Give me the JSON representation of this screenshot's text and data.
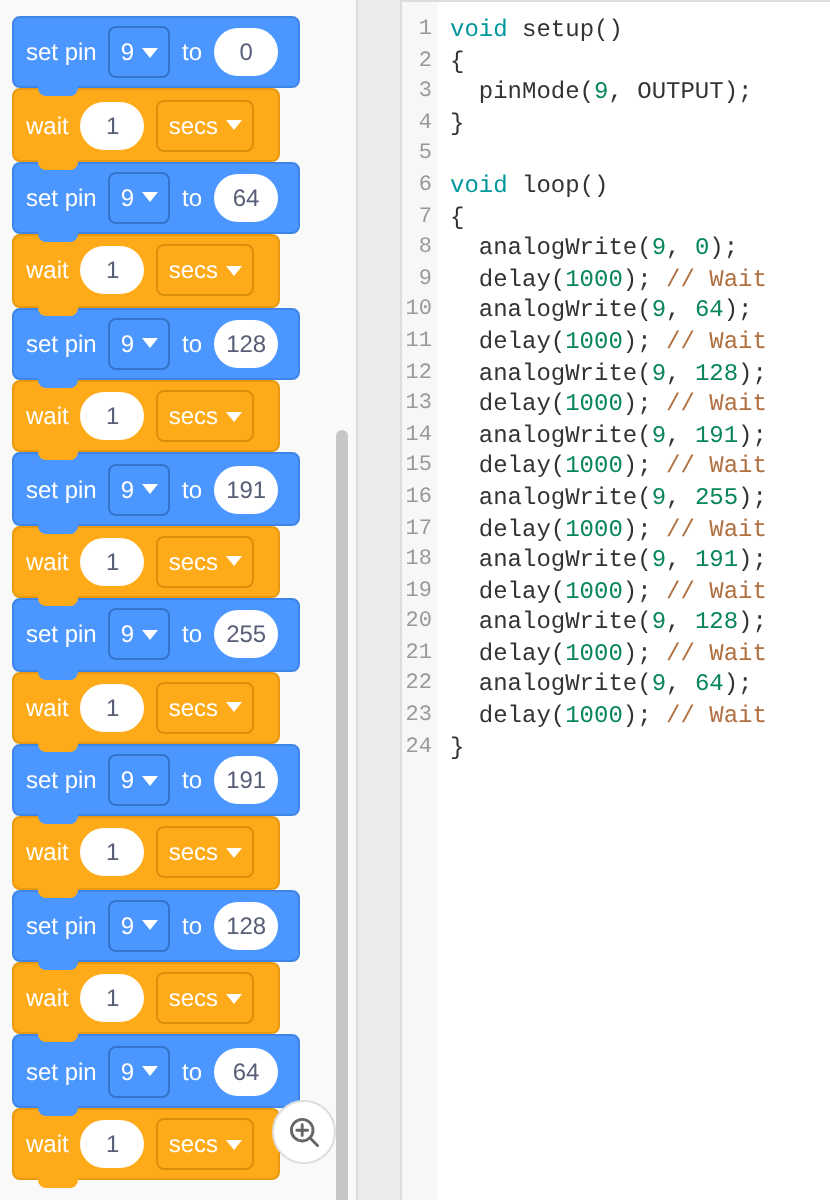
{
  "blocks": [
    {
      "kind": "set_pin",
      "label": "set pin",
      "pin": "9",
      "connector": "to",
      "value": "0"
    },
    {
      "kind": "wait",
      "label": "wait",
      "amount": "1",
      "unit": "secs"
    },
    {
      "kind": "set_pin",
      "label": "set pin",
      "pin": "9",
      "connector": "to",
      "value": "64"
    },
    {
      "kind": "wait",
      "label": "wait",
      "amount": "1",
      "unit": "secs"
    },
    {
      "kind": "set_pin",
      "label": "set pin",
      "pin": "9",
      "connector": "to",
      "value": "128"
    },
    {
      "kind": "wait",
      "label": "wait",
      "amount": "1",
      "unit": "secs"
    },
    {
      "kind": "set_pin",
      "label": "set pin",
      "pin": "9",
      "connector": "to",
      "value": "191"
    },
    {
      "kind": "wait",
      "label": "wait",
      "amount": "1",
      "unit": "secs"
    },
    {
      "kind": "set_pin",
      "label": "set pin",
      "pin": "9",
      "connector": "to",
      "value": "255"
    },
    {
      "kind": "wait",
      "label": "wait",
      "amount": "1",
      "unit": "secs"
    },
    {
      "kind": "set_pin",
      "label": "set pin",
      "pin": "9",
      "connector": "to",
      "value": "191"
    },
    {
      "kind": "wait",
      "label": "wait",
      "amount": "1",
      "unit": "secs"
    },
    {
      "kind": "set_pin",
      "label": "set pin",
      "pin": "9",
      "connector": "to",
      "value": "128"
    },
    {
      "kind": "wait",
      "label": "wait",
      "amount": "1",
      "unit": "secs"
    },
    {
      "kind": "set_pin",
      "label": "set pin",
      "pin": "9",
      "connector": "to",
      "value": "64"
    },
    {
      "kind": "wait",
      "label": "wait",
      "amount": "1",
      "unit": "secs"
    }
  ],
  "code": [
    {
      "number": "1",
      "tokens": [
        {
          "kind": "kw",
          "text": "void"
        },
        {
          "kind": "plain",
          "text": " setup()"
        }
      ]
    },
    {
      "number": "2",
      "tokens": [
        {
          "kind": "plain",
          "text": "{"
        }
      ]
    },
    {
      "number": "3",
      "tokens": [
        {
          "kind": "plain",
          "text": "  pinMode("
        },
        {
          "kind": "num",
          "text": "9"
        },
        {
          "kind": "plain",
          "text": ", OUTPUT);"
        }
      ]
    },
    {
      "number": "4",
      "tokens": [
        {
          "kind": "plain",
          "text": "}"
        }
      ]
    },
    {
      "number": "5"
    },
    {
      "number": "6",
      "tokens": [
        {
          "kind": "kw",
          "text": "void"
        },
        {
          "kind": "plain",
          "text": " loop()"
        }
      ]
    },
    {
      "number": "7",
      "tokens": [
        {
          "kind": "plain",
          "text": "{"
        }
      ]
    },
    {
      "number": "8",
      "tokens": [
        {
          "kind": "plain",
          "text": "  analogWrite("
        },
        {
          "kind": "num",
          "text": "9"
        },
        {
          "kind": "plain",
          "text": ", "
        },
        {
          "kind": "num",
          "text": "0"
        },
        {
          "kind": "plain",
          "text": ");"
        }
      ]
    },
    {
      "number": "9",
      "tokens": [
        {
          "kind": "plain",
          "text": "  delay("
        },
        {
          "kind": "num",
          "text": "1000"
        },
        {
          "kind": "plain",
          "text": "); "
        },
        {
          "kind": "comment",
          "text": "// Wait"
        }
      ]
    },
    {
      "number": "10",
      "tokens": [
        {
          "kind": "plain",
          "text": "  analogWrite("
        },
        {
          "kind": "num",
          "text": "9"
        },
        {
          "kind": "plain",
          "text": ", "
        },
        {
          "kind": "num",
          "text": "64"
        },
        {
          "kind": "plain",
          "text": ");"
        }
      ]
    },
    {
      "number": "11",
      "tokens": [
        {
          "kind": "plain",
          "text": "  delay("
        },
        {
          "kind": "num",
          "text": "1000"
        },
        {
          "kind": "plain",
          "text": "); "
        },
        {
          "kind": "comment",
          "text": "// Wait"
        }
      ]
    },
    {
      "number": "12",
      "tokens": [
        {
          "kind": "plain",
          "text": "  analogWrite("
        },
        {
          "kind": "num",
          "text": "9"
        },
        {
          "kind": "plain",
          "text": ", "
        },
        {
          "kind": "num",
          "text": "128"
        },
        {
          "kind": "plain",
          "text": ");"
        }
      ]
    },
    {
      "number": "13",
      "tokens": [
        {
          "kind": "plain",
          "text": "  delay("
        },
        {
          "kind": "num",
          "text": "1000"
        },
        {
          "kind": "plain",
          "text": "); "
        },
        {
          "kind": "comment",
          "text": "// Wait"
        }
      ]
    },
    {
      "number": "14",
      "tokens": [
        {
          "kind": "plain",
          "text": "  analogWrite("
        },
        {
          "kind": "num",
          "text": "9"
        },
        {
          "kind": "plain",
          "text": ", "
        },
        {
          "kind": "num",
          "text": "191"
        },
        {
          "kind": "plain",
          "text": ");"
        }
      ]
    },
    {
      "number": "15",
      "tokens": [
        {
          "kind": "plain",
          "text": "  delay("
        },
        {
          "kind": "num",
          "text": "1000"
        },
        {
          "kind": "plain",
          "text": "); "
        },
        {
          "kind": "comment",
          "text": "// Wait"
        }
      ]
    },
    {
      "number": "16",
      "tokens": [
        {
          "kind": "plain",
          "text": "  analogWrite("
        },
        {
          "kind": "num",
          "text": "9"
        },
        {
          "kind": "plain",
          "text": ", "
        },
        {
          "kind": "num",
          "text": "255"
        },
        {
          "kind": "plain",
          "text": ");"
        }
      ]
    },
    {
      "number": "17",
      "tokens": [
        {
          "kind": "plain",
          "text": "  delay("
        },
        {
          "kind": "num",
          "text": "1000"
        },
        {
          "kind": "plain",
          "text": "); "
        },
        {
          "kind": "comment",
          "text": "// Wait"
        }
      ]
    },
    {
      "number": "18",
      "tokens": [
        {
          "kind": "plain",
          "text": "  analogWrite("
        },
        {
          "kind": "num",
          "text": "9"
        },
        {
          "kind": "plain",
          "text": ", "
        },
        {
          "kind": "num",
          "text": "191"
        },
        {
          "kind": "plain",
          "text": ");"
        }
      ]
    },
    {
      "number": "19",
      "tokens": [
        {
          "kind": "plain",
          "text": "  delay("
        },
        {
          "kind": "num",
          "text": "1000"
        },
        {
          "kind": "plain",
          "text": "); "
        },
        {
          "kind": "comment",
          "text": "// Wait"
        }
      ]
    },
    {
      "number": "20",
      "tokens": [
        {
          "kind": "plain",
          "text": "  analogWrite("
        },
        {
          "kind": "num",
          "text": "9"
        },
        {
          "kind": "plain",
          "text": ", "
        },
        {
          "kind": "num",
          "text": "128"
        },
        {
          "kind": "plain",
          "text": ");"
        }
      ]
    },
    {
      "number": "21",
      "tokens": [
        {
          "kind": "plain",
          "text": "  delay("
        },
        {
          "kind": "num",
          "text": "1000"
        },
        {
          "kind": "plain",
          "text": "); "
        },
        {
          "kind": "comment",
          "text": "// Wait"
        }
      ]
    },
    {
      "number": "22",
      "tokens": [
        {
          "kind": "plain",
          "text": "  analogWrite("
        },
        {
          "kind": "num",
          "text": "9"
        },
        {
          "kind": "plain",
          "text": ", "
        },
        {
          "kind": "num",
          "text": "64"
        },
        {
          "kind": "plain",
          "text": ");"
        }
      ]
    },
    {
      "number": "23",
      "tokens": [
        {
          "kind": "plain",
          "text": "  delay("
        },
        {
          "kind": "num",
          "text": "1000"
        },
        {
          "kind": "plain",
          "text": "); "
        },
        {
          "kind": "comment",
          "text": "// Wait"
        }
      ]
    },
    {
      "number": "24",
      "tokens": [
        {
          "kind": "plain",
          "text": "}"
        }
      ]
    }
  ]
}
